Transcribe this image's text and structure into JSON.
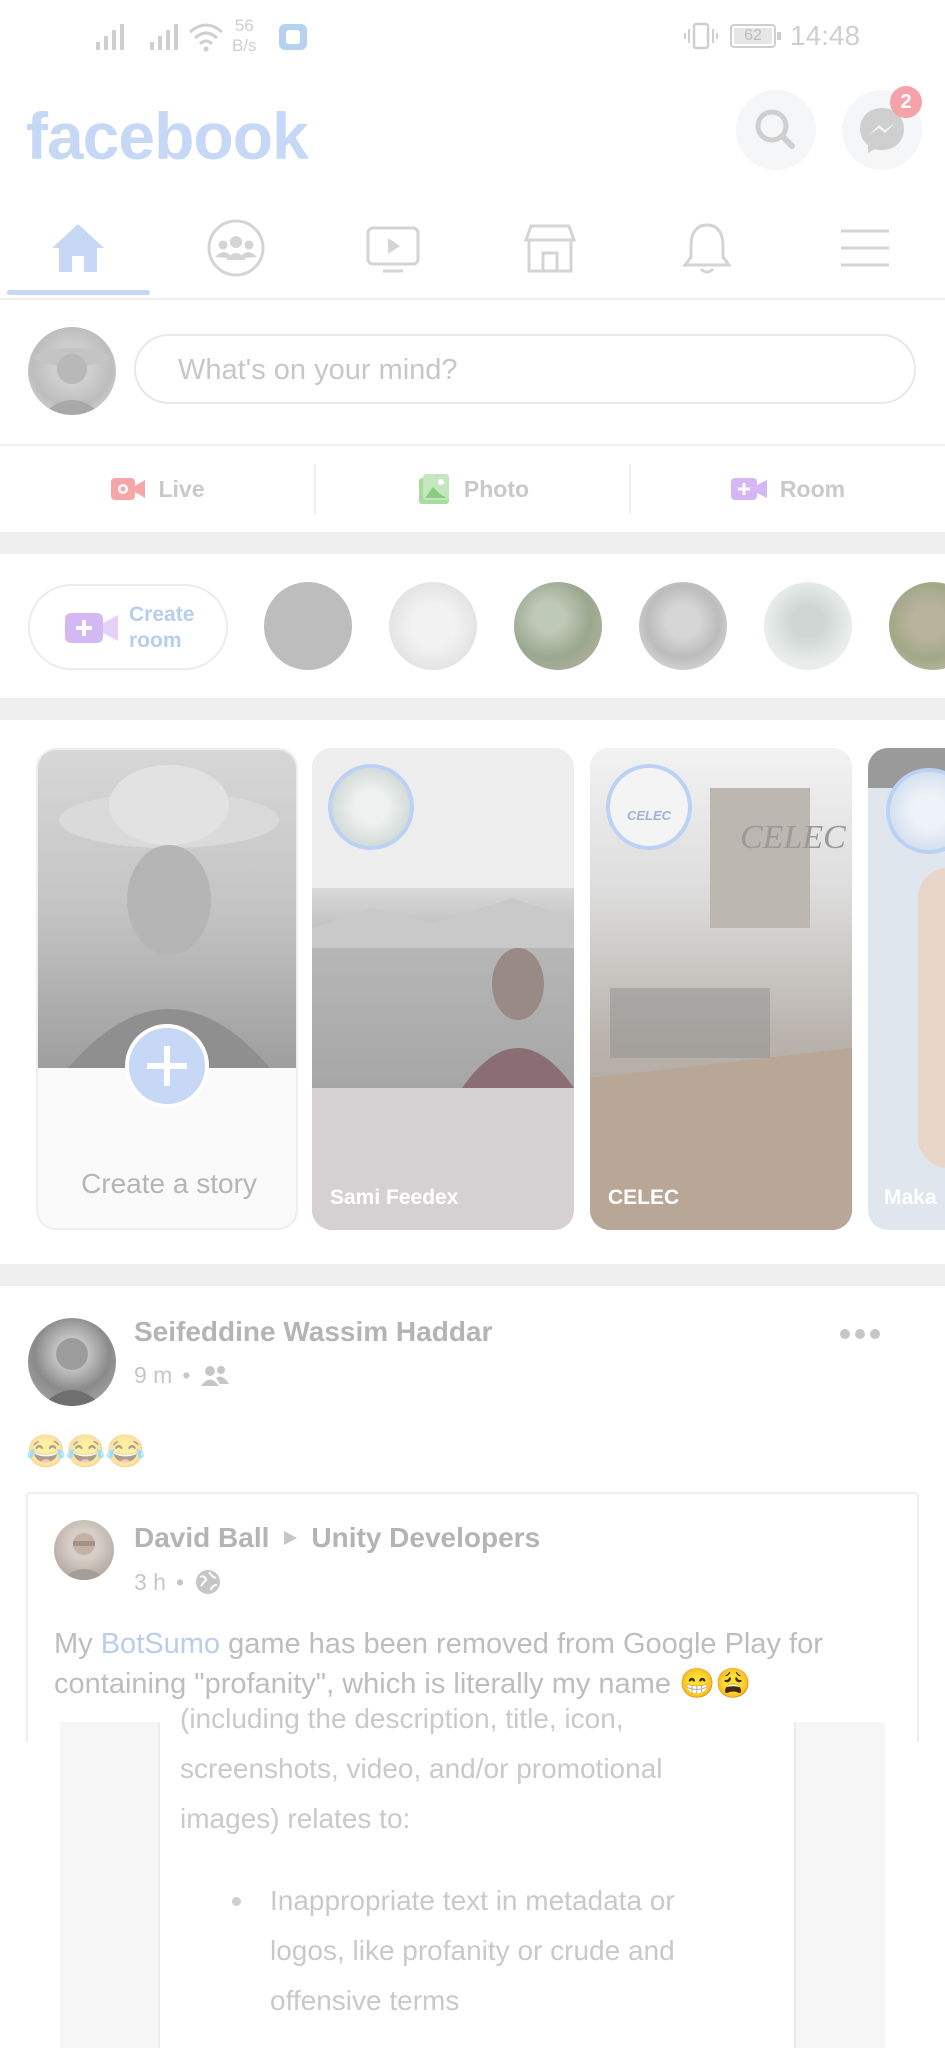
{
  "status_bar": {
    "speed_value": "56",
    "speed_unit": "B/s",
    "battery": "62",
    "time": "14:48"
  },
  "header": {
    "logo": "facebook",
    "messenger_badge": "2"
  },
  "tabs": [
    {
      "name": "home",
      "active": true
    },
    {
      "name": "groups"
    },
    {
      "name": "watch"
    },
    {
      "name": "marketplace"
    },
    {
      "name": "notifications"
    },
    {
      "name": "menu"
    }
  ],
  "composer": {
    "placeholder": "What's on your mind?",
    "actions": {
      "live": "Live",
      "photo": "Photo",
      "room": "Room"
    }
  },
  "rooms": {
    "create_line1": "Create",
    "create_line2": "room"
  },
  "stories": [
    {
      "label": "Create a story"
    },
    {
      "label": "Sami Feedex"
    },
    {
      "label": "CELEC",
      "ring_text": "CELEC"
    },
    {
      "label": "Maka"
    }
  ],
  "post": {
    "author": "Seifeddine Wassim Haddar",
    "time": "9 m",
    "emoji_text": "😂😂😂",
    "shared": {
      "author": "David Ball",
      "group": "Unity Developers",
      "time": "3 h",
      "text_before": "My ",
      "link": "BotSumo",
      "text_after": " game has been removed from Google Play for containing \"profanity\", which is literally my name 😁😩"
    },
    "screenshot": {
      "line0": "(including the description, title, icon,",
      "line1": "screenshots, video, and/or promotional",
      "line2": "images) relates to:",
      "bullet1": "Inappropriate text in metadata or",
      "bullet2": "logos, like profanity or crude and",
      "bullet3": "offensive terms"
    }
  },
  "colors": {
    "brand": "#c6d8f5",
    "live": "#f6a6a6",
    "photo": "#a9dba1",
    "room": "#d4b8f4"
  }
}
